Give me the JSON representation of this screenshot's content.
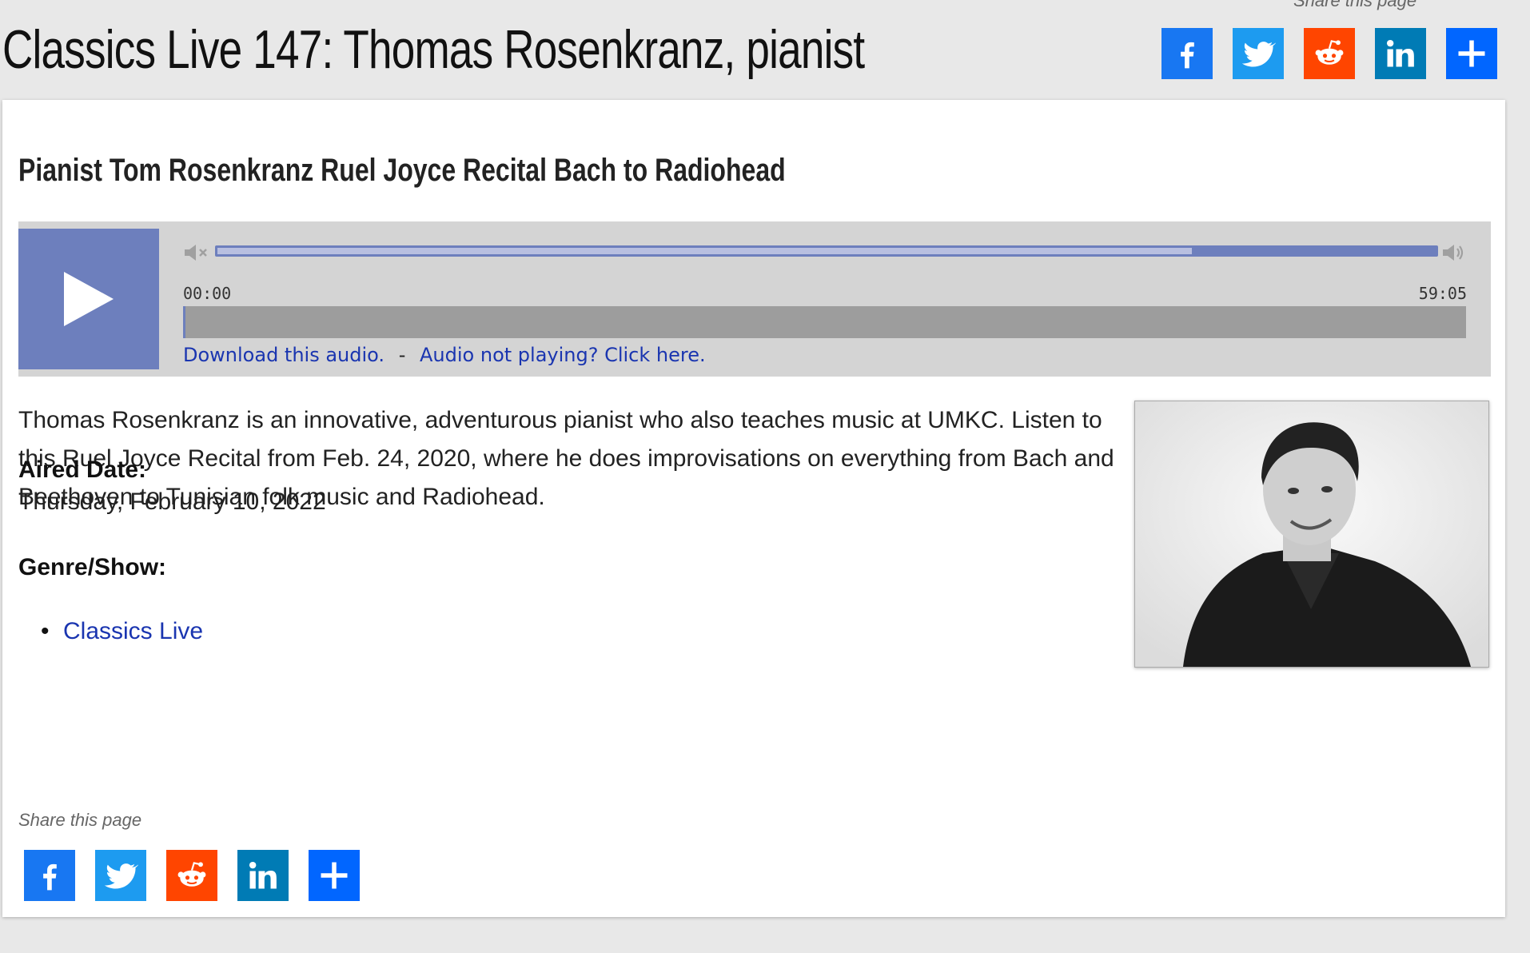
{
  "page": {
    "title": "Classics Live 147: Thomas Rosenkranz, pianist",
    "top_share_label": "Share this page"
  },
  "share_buttons": [
    {
      "name": "facebook",
      "icon": "facebook-icon",
      "color": "#1877f2"
    },
    {
      "name": "twitter",
      "icon": "twitter-icon",
      "color": "#1d9bf0"
    },
    {
      "name": "reddit",
      "icon": "reddit-icon",
      "color": "#ff4500"
    },
    {
      "name": "linkedin",
      "icon": "linkedin-icon",
      "color": "#007bb5"
    },
    {
      "name": "more",
      "icon": "plus-icon",
      "color": "#0166ff"
    }
  ],
  "content": {
    "subtitle": "Pianist Tom Rosenkranz Ruel Joyce Recital Bach to Radiohead",
    "description": "Thomas Rosenkranz is an innovative, adventurous pianist who also teaches music at UMKC. Listen to this Ruel Joyce Recital from Feb. 24, 2020, where he does improvisations on everything from Bach and Beethoven to Tunisian folk music and Radiohead.",
    "aired_label": "Aired Date:",
    "aired_value": "Thursday, February 10, 2022",
    "genre_label": "Genre/Show:",
    "genres": [
      "Classics Live"
    ],
    "share_label": "Share this page"
  },
  "player": {
    "current_time": "00:00",
    "duration": "59:05",
    "volume_level": 0.8,
    "progress": 0.0,
    "download_link": "Download this audio.",
    "separator": "-",
    "help_link": "Audio not playing? Click here.",
    "accent_color": "#6d7fbd"
  }
}
